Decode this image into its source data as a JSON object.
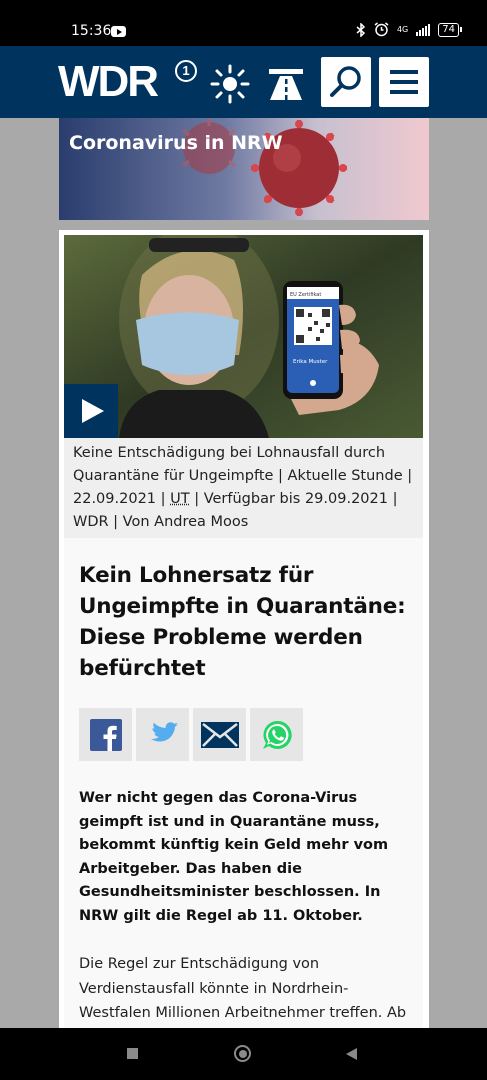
{
  "status_bar": {
    "time": "15:36",
    "network": "4G",
    "battery": "74"
  },
  "header": {
    "logo_text": "WDR",
    "logo_superscript": "1",
    "icons": [
      "weather-icon",
      "traffic-icon",
      "search-icon",
      "menu-icon"
    ],
    "colors": {
      "brand": "#00345e"
    }
  },
  "banner": {
    "title": "Coronavirus in NRW"
  },
  "media": {
    "phone_header": "EU Zertifikat",
    "phone_name": "Erika Muster",
    "caption_lines": [
      "Keine Entschädigung bei Lohnausfall durch",
      "Quarantäne für Ungeimpfte | Aktuelle Stunde |",
      "22.09.2021 | ",
      "UT",
      " | Verfügbar bis 29.09.2021 |",
      "WDR | Von Andrea Moos"
    ]
  },
  "article": {
    "headline": "Kein Lohnersatz für Ungeimpfte in Quarantäne: Diese Probleme werden befürchtet",
    "share_buttons": [
      "facebook-icon",
      "twitter-icon",
      "email-icon",
      "whatsapp-icon"
    ],
    "lead": "Wer nicht gegen das Corona-Virus geimpft ist und in Quarantäne muss, bekommt künftig kein Geld mehr vom Arbeitgeber. Das haben die Gesundheitsminister beschlossen. In NRW gilt die Regel ab 11. Oktober.",
    "body": "Die Regel zur Entschädigung von Verdienstausfall könnte in Nordrhein-Westfalen Millionen Arbeitnehmer treffen. Ab Mitte Oktober müssen ungeimpfte"
  }
}
